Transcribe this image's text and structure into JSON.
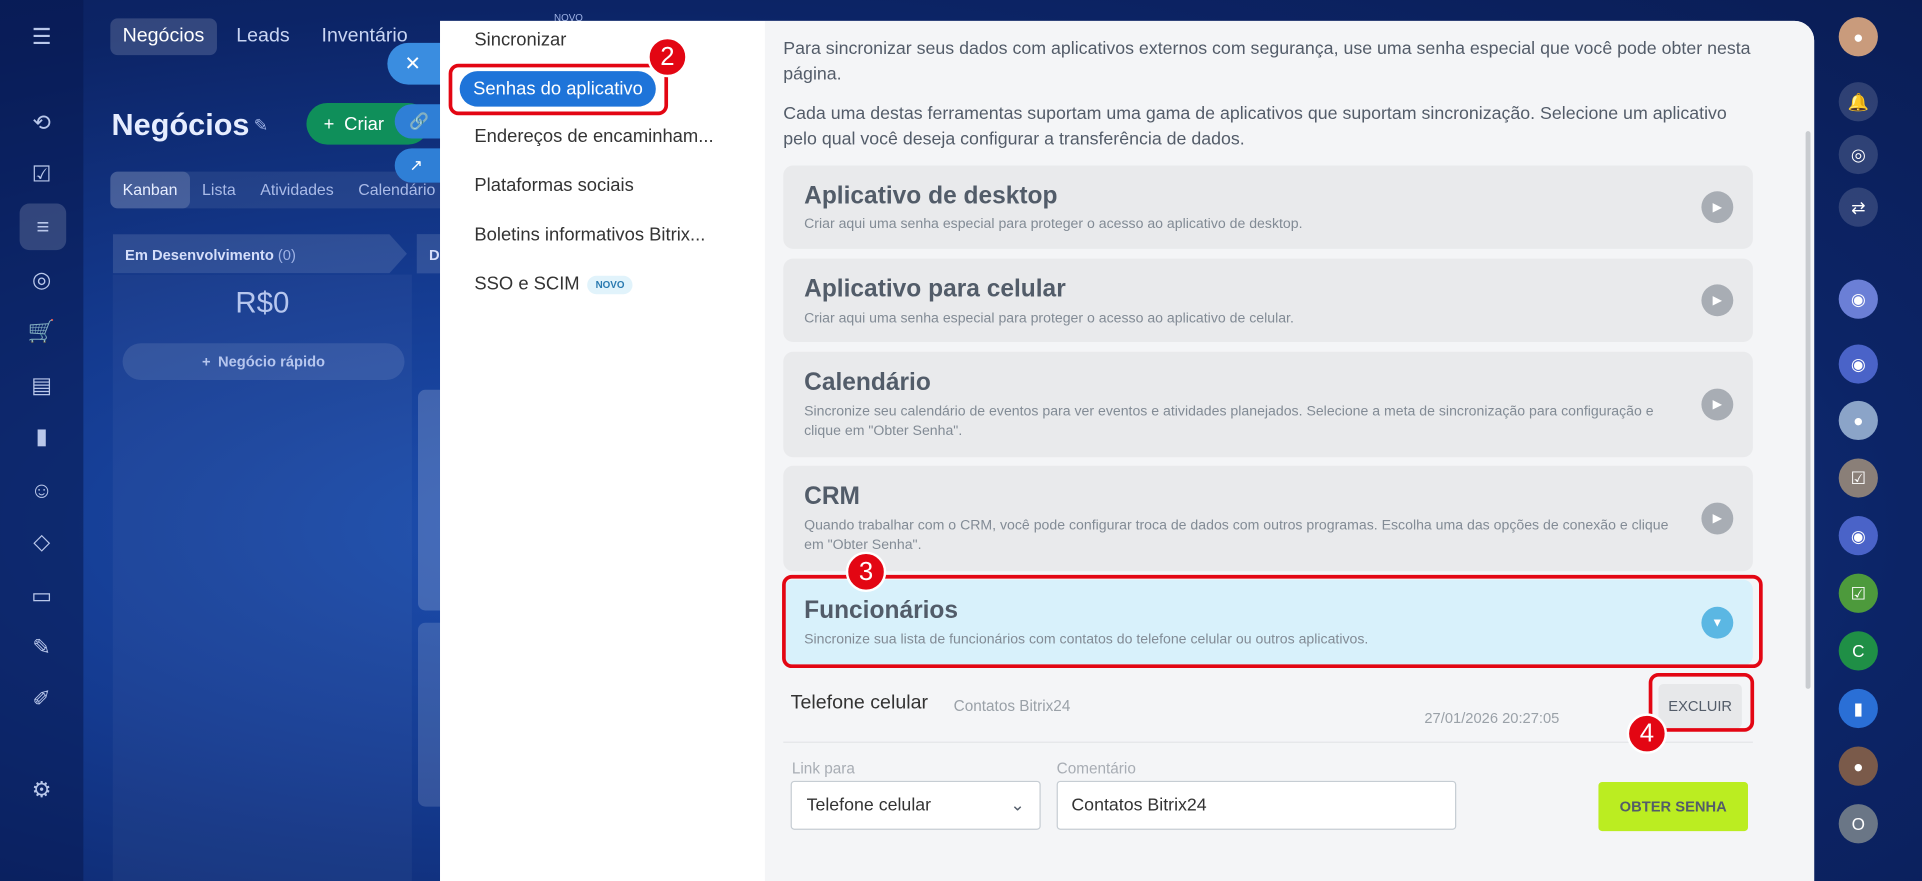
{
  "topnav": {
    "items": [
      "Negócios",
      "Leads",
      "Inventário"
    ],
    "novo": "NOVO"
  },
  "page": {
    "title": "Negócios",
    "create_label": "Criar"
  },
  "subtabs": [
    "Kanban",
    "Lista",
    "Atividades",
    "Calendário"
  ],
  "kanban": {
    "column_title": "Em Desenvolvimento",
    "column_count": "(0)",
    "column2_initial": "D",
    "sum": "R$0",
    "quick_add": "Negócio rápido"
  },
  "menu": {
    "items": [
      "Sincronizar",
      "Senhas do aplicativo",
      "Endereços de encaminham...",
      "Plataformas sociais",
      "Boletins informativos Bitrix...",
      "SSO e SCIM"
    ],
    "novo_badge": "NOVO"
  },
  "content": {
    "intro1": "Para sincronizar seus dados com aplicativos externos com segurança, use uma senha especial que você pode obter nesta página.",
    "intro2": "Cada uma destas ferramentas suportam uma gama de aplicativos que suportam sincronização. Selecione um aplicativo pelo qual você deseja configurar a transferência de dados.",
    "sections": [
      {
        "title": "Aplicativo de desktop",
        "desc": "Criar aqui uma senha especial para proteger o acesso ao aplicativo de desktop."
      },
      {
        "title": "Aplicativo para celular",
        "desc": "Criar aqui uma senha especial para proteger o acesso ao aplicativo de celular."
      },
      {
        "title": "Calendário",
        "desc": "Sincronize seu calendário de eventos para ver eventos e atividades planejados. Selecione a meta de sincronização para configuração e clique em \"Obter Senha\"."
      },
      {
        "title": "CRM",
        "desc": "Quando trabalhar com o CRM, você pode configurar troca de dados com outros programas. Escolha uma das opções de conexão e clique em \"Obter Senha\"."
      },
      {
        "title": "Funcionários",
        "desc": "Sincronize sua lista de funcionários com contatos do telefone celular ou outros aplicativos."
      }
    ],
    "password_row": {
      "name": "Telefone celular",
      "comment": "Contatos Bitrix24",
      "date": "27/01/2026 20:27:05",
      "delete_label": "EXCLUIR"
    },
    "form": {
      "link_label": "Link para",
      "link_value": "Telefone celular",
      "comment_label": "Comentário",
      "comment_value": "Contatos Bitrix24",
      "submit_label": "OBTER SENHA"
    }
  },
  "annotations": [
    "2",
    "3",
    "4"
  ],
  "rightbar": {
    "letter_c": "C",
    "letter_o": "O"
  },
  "colors": {
    "accent_blue": "#1e74d9",
    "highlight_red": "#e30613",
    "button_lime": "#bbed21",
    "open_section": "#d8f1fb"
  }
}
